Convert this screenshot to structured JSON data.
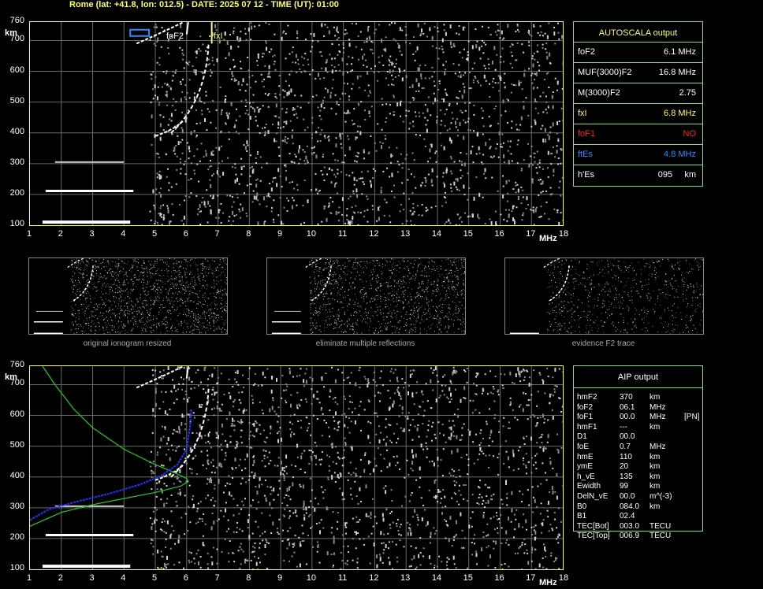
{
  "header": "Rome (lat: +41.8, lon: 012.5) - DATE: 2025 07 12 - TIME (UT): 01:00",
  "axes": {
    "y_ticks": [
      "760",
      "700",
      "600",
      "500",
      "400",
      "300",
      "200",
      "100"
    ],
    "y_unit": "km",
    "x_ticks": [
      "1",
      "2",
      "3",
      "4",
      "5",
      "6",
      "7",
      "8",
      "9",
      "10",
      "11",
      "12",
      "13",
      "14",
      "15",
      "16",
      "17",
      "18"
    ],
    "x_unit": "MHz"
  },
  "top_labels": {
    "fof2": "foF2",
    "fxi": "fxI"
  },
  "autoscala": {
    "title": "AUTOSCALA output",
    "rows": [
      {
        "key": "foF2",
        "value": "6.1 MHz",
        "color": "#ffffff"
      },
      {
        "key": "MUF(3000)F2",
        "value": "16.8 MHz",
        "color": "#ffffff"
      },
      {
        "key": "M(3000)F2",
        "value": "2.75",
        "color": "#ffffff"
      },
      {
        "key": "fxI",
        "value": "6.8 MHz",
        "color": "#ffff66"
      },
      {
        "key": "foF1",
        "value": "NO",
        "color": "#ff2020"
      },
      {
        "key": "ftEs",
        "value": "4.8 MHz",
        "color": "#2a8cff"
      },
      {
        "key": "h'Es",
        "value": "095     km",
        "color": "#ffffff"
      }
    ]
  },
  "thumbnails": [
    {
      "caption": "original ionogram resized"
    },
    {
      "caption": "eliminate multiple reflections"
    },
    {
      "caption": "evidence F2 trace"
    }
  ],
  "aip": {
    "title": "AIP output",
    "rows": [
      [
        "hmF2",
        "370",
        "km",
        ""
      ],
      [
        "foF2",
        "06.1",
        "MHz",
        ""
      ],
      [
        "foF1",
        "00.0",
        "MHz",
        "[PN]"
      ],
      [
        "hmF1",
        "---",
        "km",
        ""
      ],
      [
        "D1",
        "00.0",
        "",
        ""
      ],
      [
        "foE",
        "0.7",
        "MHz",
        ""
      ],
      [
        "hmE",
        "110",
        "km",
        ""
      ],
      [
        "ymE",
        "20",
        "km",
        ""
      ],
      [
        "h_vE",
        "135",
        "km",
        ""
      ],
      [
        "Ewidth",
        "99",
        "km",
        ""
      ],
      [
        "DelN_vE",
        "00.0",
        "m^(-3)",
        ""
      ],
      [
        "B0",
        "084.0",
        "km",
        ""
      ],
      [
        "B1",
        "02.4",
        "",
        ""
      ],
      [
        "TEC[Bot]",
        "003.0",
        "TECU",
        ""
      ],
      [
        "TEC[Top]",
        "006.9",
        "TECU",
        ""
      ]
    ]
  },
  "colors": {
    "axis": "#ffff66",
    "panel_border": "#7fdc7f",
    "profile": "#22cc22",
    "ne_profile": "#2233ff",
    "es_marker": "#2a8cff"
  }
}
